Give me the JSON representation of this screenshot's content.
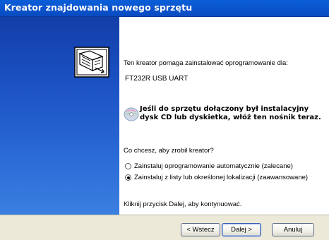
{
  "window": {
    "title": "Kreator znajdowania nowego sprzętu"
  },
  "content": {
    "intro": "Ten kreator pomaga zainstalować oprogramowanie dla:",
    "device": "FT232R USB UART",
    "cd_line1": "Jeśli do sprzętu dołączony był instalacyjny",
    "cd_line2": "dysk CD lub dyskietka, włóż ten nośnik teraz.",
    "question": "Co chcesz, aby zrobił kreator?",
    "options": [
      {
        "label": "Zainstaluj oprogramowanie automatycznie (zalecane)",
        "selected": false
      },
      {
        "label": "Zainstaluj z listy lub określonej lokalizacji (zaawansowane)",
        "selected": true
      }
    ],
    "hint": "Kliknij przycisk Dalej, aby kontynuować."
  },
  "buttons": {
    "back": "< Wstecz",
    "next": "Dalej >",
    "cancel": "Anuluj"
  },
  "colors": {
    "title_bar": "#0b55cf",
    "sidebar_top": "#123ea8",
    "sidebar_bottom": "#3a7fe0",
    "footer": "#ece9d8"
  },
  "icons": {
    "wizard": "hardware-wizard-icon",
    "cd": "cd-disk-icon"
  }
}
